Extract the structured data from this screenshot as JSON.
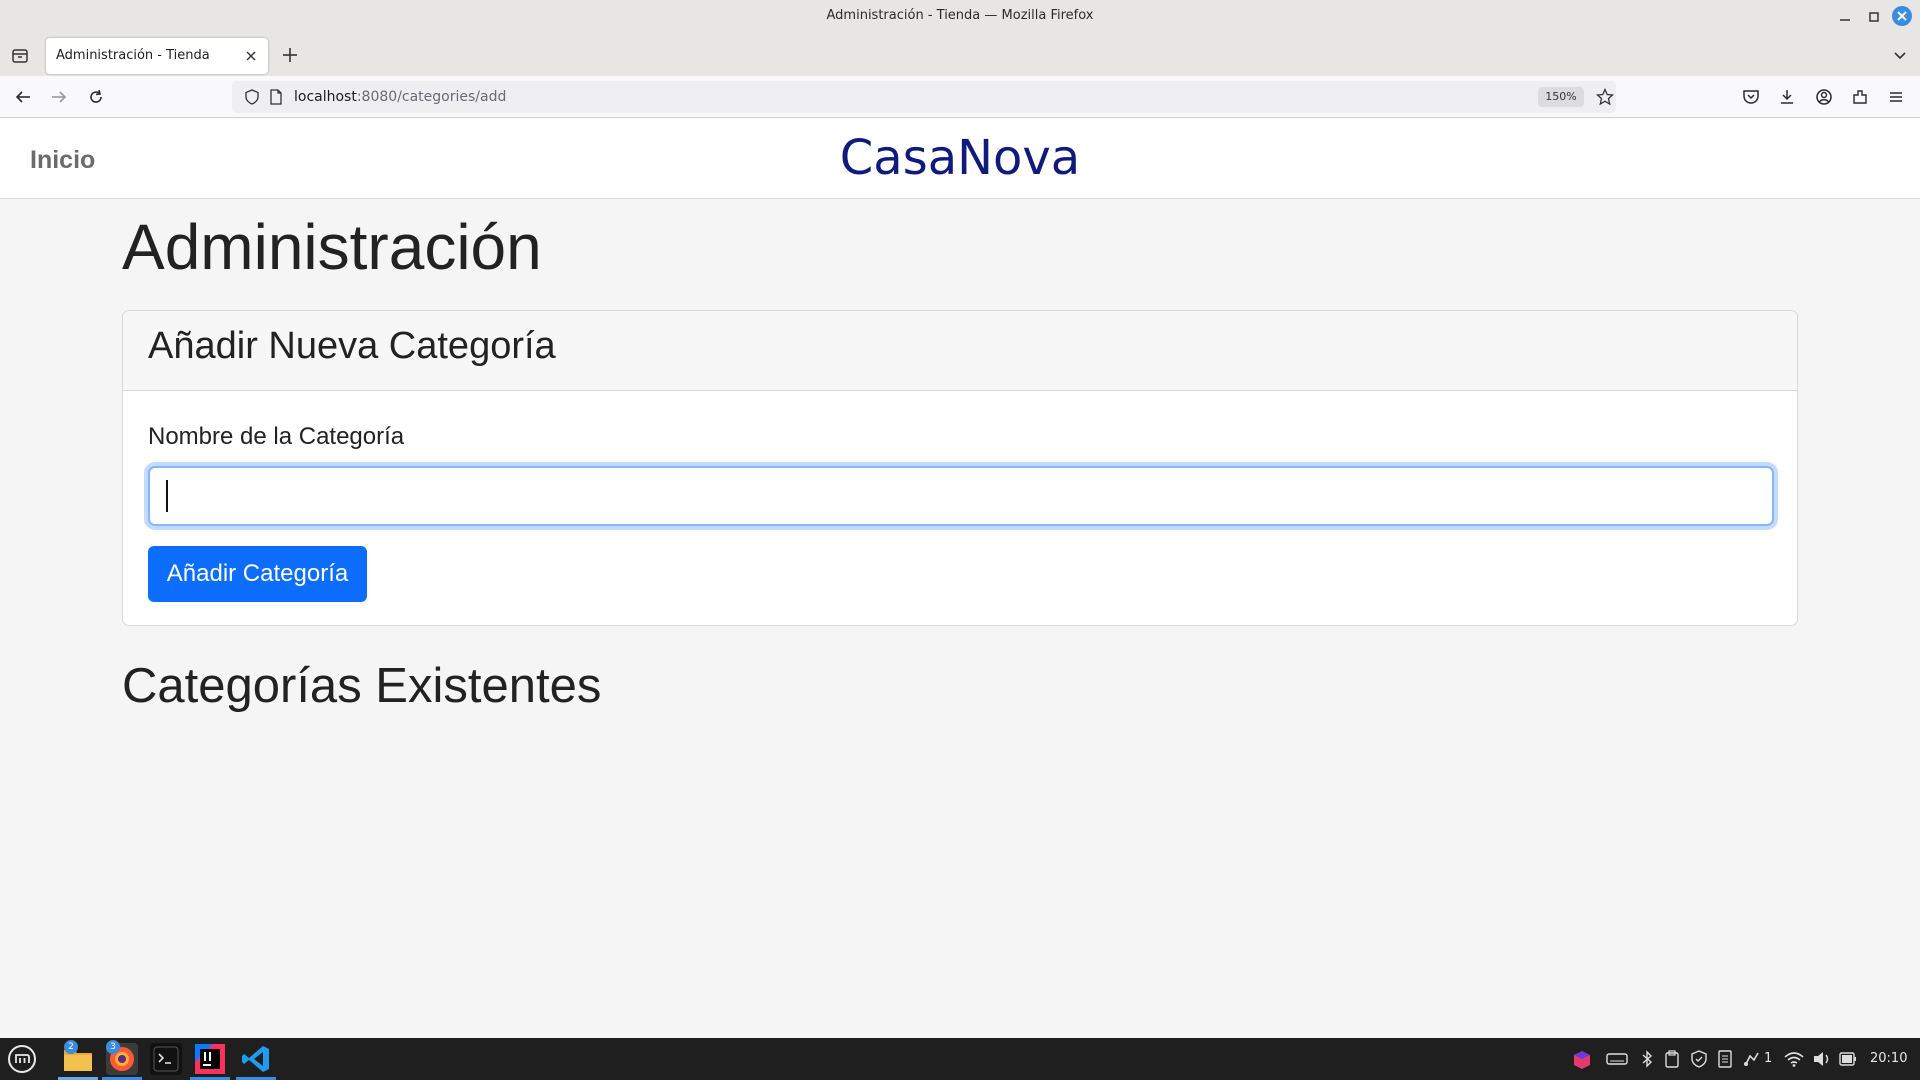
{
  "window": {
    "title": "Administración - Tienda — Mozilla Firefox"
  },
  "tabs": [
    {
      "title": "Administración - Tienda"
    }
  ],
  "navbar": {
    "url_host": "localhost",
    "url_rest": ":8080/categories/add",
    "zoom": "150%"
  },
  "site": {
    "nav_home": "Inicio",
    "brand": "CasaNova"
  },
  "main": {
    "title": "Administración",
    "card": {
      "title": "Añadir Nueva Categoría",
      "field_label": "Nombre de la Categoría",
      "field_value": "",
      "submit_label": "Añadir Categoría"
    },
    "list_title": "Categorías Existentes"
  },
  "taskbar": {
    "apps": [
      {
        "name": "files",
        "badge": "2"
      },
      {
        "name": "firefox",
        "badge": "3"
      },
      {
        "name": "terminal"
      },
      {
        "name": "intellij"
      },
      {
        "name": "vscode"
      }
    ],
    "tray": {
      "notifications_count": "1",
      "clock": "20:10"
    }
  },
  "colors": {
    "brand": "#0f1a7a",
    "primary_button": "#0d6efd",
    "focus_ring": "#86b7fe"
  }
}
